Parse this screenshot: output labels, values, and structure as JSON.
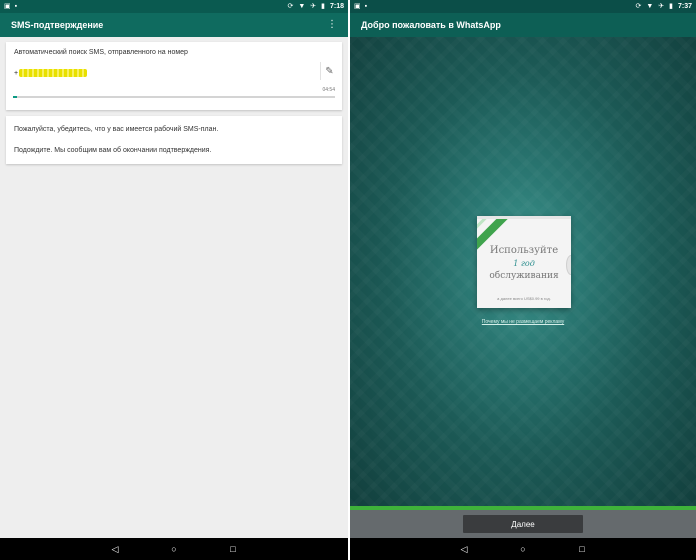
{
  "left": {
    "status": {
      "time": "7:18"
    },
    "appbar": {
      "title": "SMS-подтверждение",
      "menu_icon": "more-vert-icon"
    },
    "sms_card": {
      "search_text": "Автоматический поиск SMS, отправленного на номер",
      "phone_prefix": "+",
      "timer": "04:54",
      "edit_icon": "pencil-icon"
    },
    "info_card": {
      "line1": "Пожалуйста, убедитесь, что у вас имеется рабочий SMS-план.",
      "line2": "Подождите. Мы сообщим вам об окончании подтверждения."
    },
    "nav": {
      "back": "◁",
      "home": "○",
      "recents": "□"
    }
  },
  "right": {
    "status": {
      "time": "7:37"
    },
    "appbar": {
      "title": "Добро пожаловать в WhatsApp"
    },
    "promo": {
      "line1": "Используйте",
      "line2": "1 год",
      "line3": "обслуживания",
      "price_text": "а далее всего US$0.99 в год."
    },
    "ads_link": "Почему мы не размещаем рекламу",
    "next_button": "Далее",
    "nav": {
      "back": "◁",
      "home": "○",
      "recents": "□"
    }
  },
  "colors": {
    "accent": "#0f6b5f",
    "green": "#3fb23a",
    "progress": "#0b9a84"
  }
}
